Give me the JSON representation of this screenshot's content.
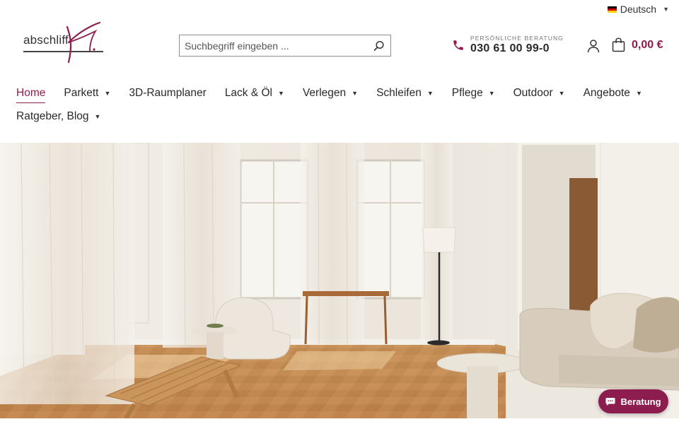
{
  "language": {
    "label": "Deutsch",
    "flag_colors": [
      "#000000",
      "#dd0000",
      "#ffce00"
    ]
  },
  "brand": {
    "logo_text": "abschliff",
    "accent_color": "#8d1d4f"
  },
  "search": {
    "placeholder": "Suchbegriff eingeben ...",
    "value": "",
    "icon": "search-icon"
  },
  "consultation": {
    "label": "PERSÖNLICHE BERATUNG",
    "phone": "030 61 00 99-0",
    "icon": "phone-icon"
  },
  "account": {
    "icon": "user-icon"
  },
  "cart": {
    "total": "0,00 €",
    "icon": "shopping-bag-icon"
  },
  "nav": {
    "items": [
      {
        "label": "Home",
        "active": true,
        "dropdown": false
      },
      {
        "label": "Parkett",
        "active": false,
        "dropdown": true
      },
      {
        "label": "3D-Raumplaner",
        "active": false,
        "dropdown": false
      },
      {
        "label": "Lack & Öl",
        "active": false,
        "dropdown": true
      },
      {
        "label": "Verlegen",
        "active": false,
        "dropdown": true
      },
      {
        "label": "Schleifen",
        "active": false,
        "dropdown": true
      },
      {
        "label": "Pflege",
        "active": false,
        "dropdown": true
      },
      {
        "label": "Outdoor",
        "active": false,
        "dropdown": true
      },
      {
        "label": "Angebote",
        "active": false,
        "dropdown": true
      },
      {
        "label": "Ratgeber, Blog",
        "active": false,
        "dropdown": true
      }
    ]
  },
  "chat": {
    "label": "Beratung",
    "icon": "chat-bubble-icon"
  }
}
